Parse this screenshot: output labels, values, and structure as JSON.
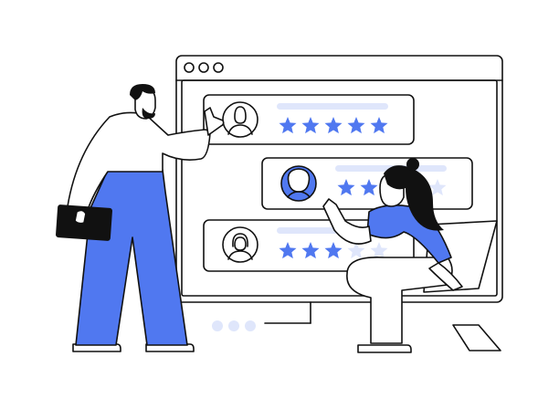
{
  "colors": {
    "accent_blue": "#5078f0",
    "light_blue": "#dfe6fb",
    "ink": "#111111",
    "background": "#ffffff"
  },
  "reviews": [
    {
      "rating": 5,
      "max": 5,
      "avatar": "man-avatar-icon"
    },
    {
      "rating": 2,
      "max": 5,
      "avatar": "curly-hair-avatar-icon"
    },
    {
      "rating": 3,
      "max": 5,
      "avatar": "woman-avatar-icon"
    }
  ],
  "window": {
    "controls": 3,
    "pager_dots": 3
  }
}
